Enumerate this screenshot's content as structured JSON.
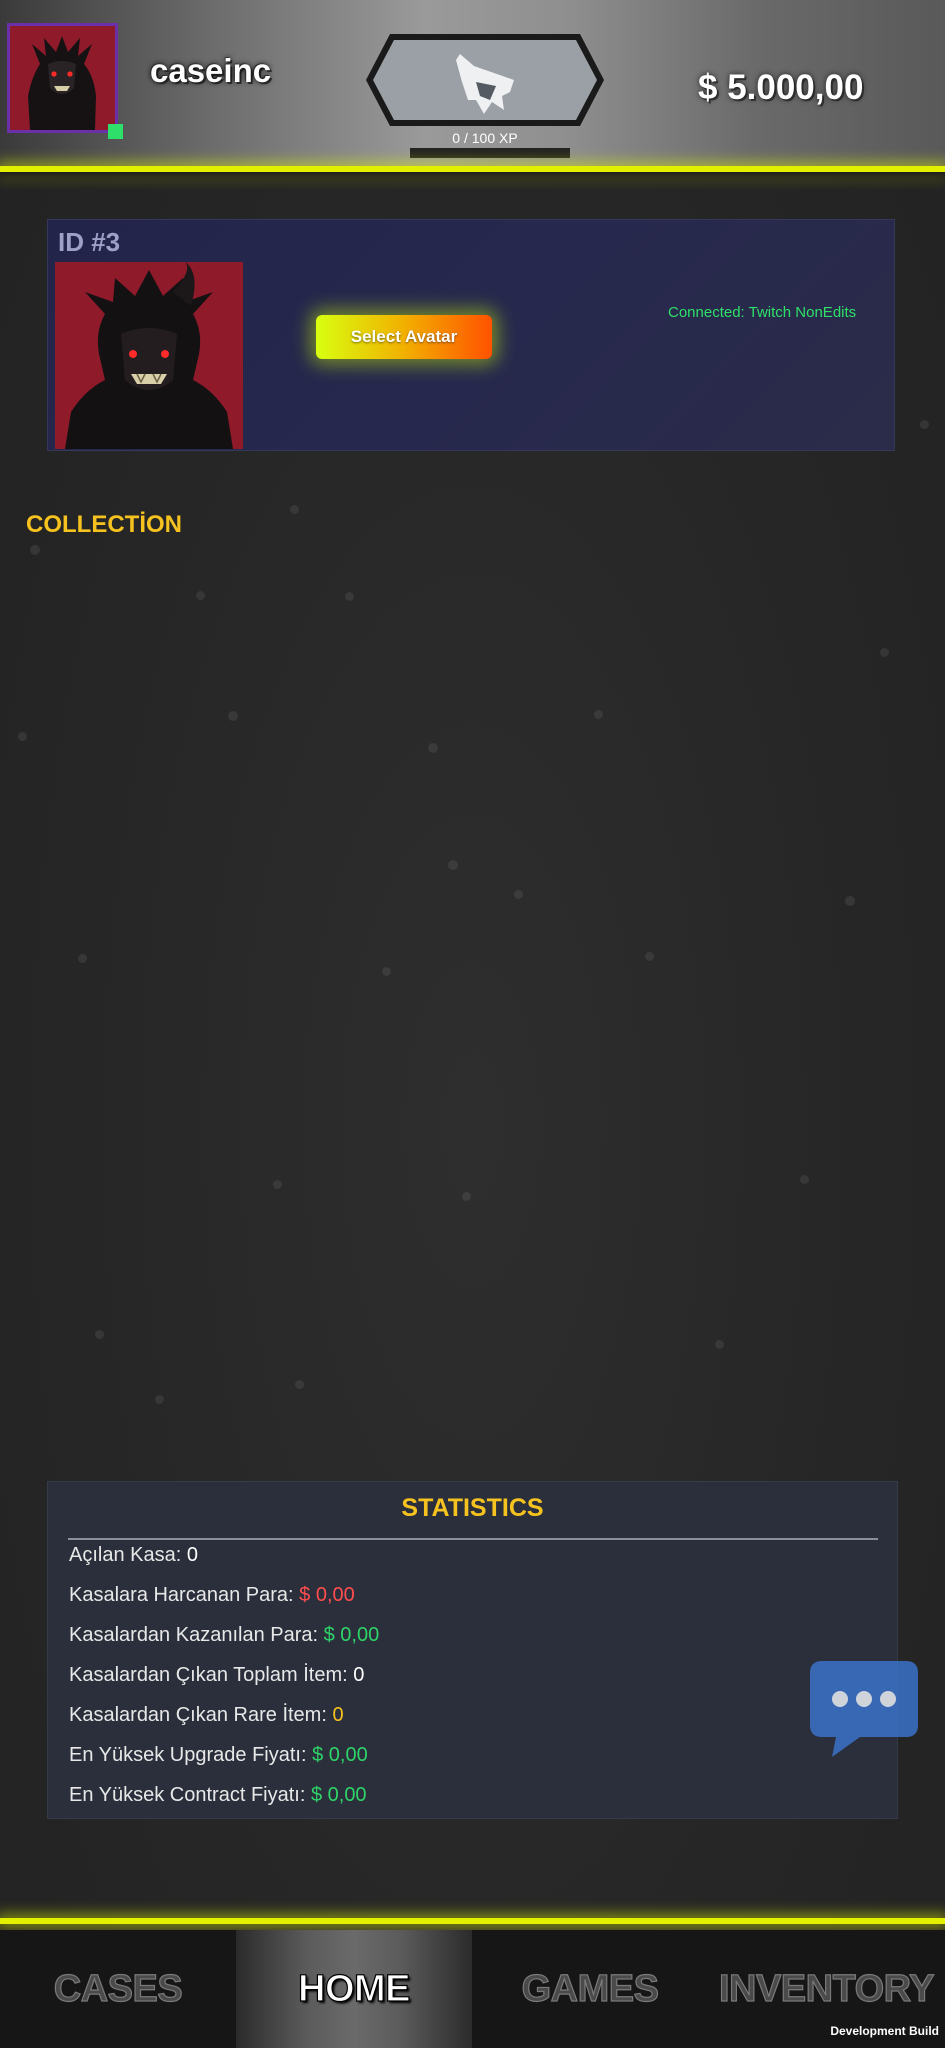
{
  "header": {
    "username": "caseinc",
    "xp_text": "0 / 100 XP",
    "xp_progress": 0,
    "balance": "$ 5.000,00",
    "avatar_icon": "demon-avatar-icon",
    "rank_icon": "wolf-rank-icon"
  },
  "profile": {
    "id_label": "ID #3",
    "select_avatar_label": "Select Avatar",
    "connected_text": "Connected: Twitch NonEdits"
  },
  "collection": {
    "title": "COLLECTİON"
  },
  "statistics": {
    "title": "STATISTICS",
    "rows": [
      {
        "label": "Açılan Kasa: ",
        "value": "0",
        "color": "white"
      },
      {
        "label": "Kasalara Harcanan Para: ",
        "value": "$ 0,00",
        "color": "red"
      },
      {
        "label": "Kasalardan Kazanılan Para: ",
        "value": "$ 0,00",
        "color": "green"
      },
      {
        "label": "Kasalardan Çıkan Toplam İtem: ",
        "value": "0",
        "color": "white"
      },
      {
        "label": "Kasalardan Çıkan Rare İtem: ",
        "value": "0",
        "color": "yellow"
      },
      {
        "label": "En Yüksek Upgrade Fiyatı: ",
        "value": "$ 0,00",
        "color": "green"
      },
      {
        "label": "En Yüksek Contract Fiyatı: ",
        "value": "$ 0,00",
        "color": "green"
      }
    ]
  },
  "nav": {
    "tabs": [
      {
        "label": "CASES",
        "active": false
      },
      {
        "label": "HOME",
        "active": true
      },
      {
        "label": "GAMES",
        "active": false
      },
      {
        "label": "INVENTORY",
        "active": false
      }
    ]
  },
  "footer": {
    "dev_build": "Development Build"
  },
  "colors": {
    "accent_yellow": "#e3f000",
    "title_gold": "#f6c21f",
    "value_red": "#ff4d4d",
    "value_green": "#2ed468",
    "chat_blue": "#3a6fc4"
  }
}
